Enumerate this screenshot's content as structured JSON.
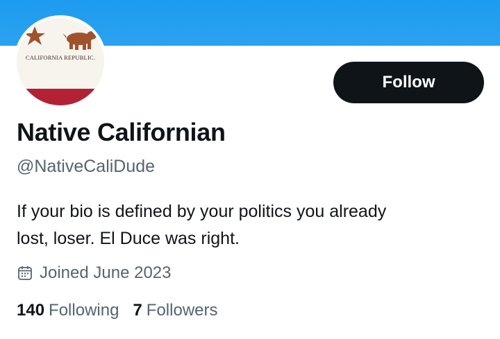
{
  "profile": {
    "display_name": "Native Californian",
    "handle": "@NativeCaliDude",
    "bio_line1": "If your bio is defined by your politics you already",
    "bio_line2": "lost, loser. El Duce was right.",
    "joined": "Joined June 2023",
    "avatar_text": "CALIFORNIA REPUBLIC."
  },
  "actions": {
    "follow_label": "Follow"
  },
  "stats": {
    "following_count": "140",
    "following_label": "Following",
    "followers_count": "7",
    "followers_label": "Followers"
  },
  "icons": {
    "joined": "calendar-icon"
  },
  "colors": {
    "banner": "#1d9bf0",
    "button_bg": "#0f1419",
    "secondary_text": "#536471",
    "flag_red": "#b22234",
    "flag_brown": "#a0522d"
  }
}
